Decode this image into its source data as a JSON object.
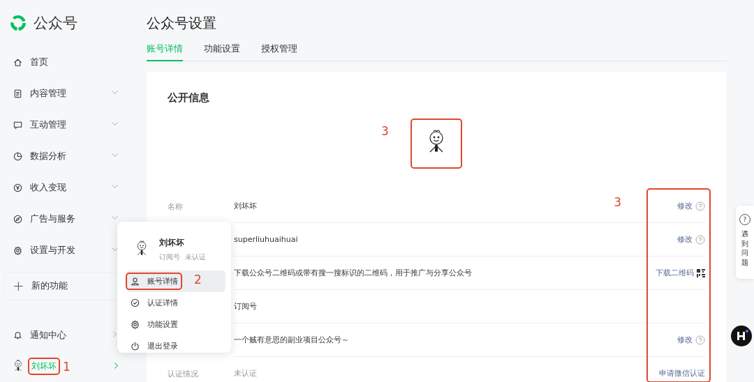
{
  "sidebar": {
    "brand": "公众号",
    "items": [
      {
        "label": "首页",
        "expandable": false
      },
      {
        "label": "内容管理",
        "expandable": true
      },
      {
        "label": "互动管理",
        "expandable": true
      },
      {
        "label": "数据分析",
        "expandable": true
      },
      {
        "label": "收入变现",
        "expandable": true
      },
      {
        "label": "广告与服务",
        "expandable": true
      },
      {
        "label": "设置与开发",
        "expandable": true
      }
    ],
    "new_feature": {
      "icon": "+",
      "label": "新的功能"
    },
    "notifications": {
      "label": "通知中心"
    },
    "user": {
      "name": "刘坏坏",
      "highlighted": true,
      "annotation": "1"
    }
  },
  "page": {
    "title": "公众号设置",
    "tabs": [
      {
        "label": "账号详情",
        "selected": true
      },
      {
        "label": "功能设置",
        "selected": false
      },
      {
        "label": "授权管理",
        "selected": false
      }
    ]
  },
  "card": {
    "title": "公开信息",
    "avatar_highlighted": true,
    "avatar_annotation": "3",
    "actions_highlighted": true,
    "actions_annotation": "3",
    "rows": [
      {
        "label": "名称",
        "value": "刘坏坏",
        "action": "修改",
        "kind": "help",
        "muted": false
      },
      {
        "value": "superliuhuaihuai",
        "action": "修改",
        "kind": "help",
        "muted": false
      },
      {
        "value": "下载公众号二维码或带有搜一搜标识的二维码，用于推广与分享公众号",
        "action": "下载二维码",
        "kind": "qr",
        "muted": false
      },
      {
        "value": "订阅号",
        "muted": false
      },
      {
        "value": "一个贼有意思的副业项目公众号～",
        "action": "修改",
        "kind": "help",
        "muted": false
      },
      {
        "label": "认证情况",
        "value": "未认证",
        "action": "申请微信认证",
        "kind": "plain",
        "muted": true
      }
    ]
  },
  "account_menu": {
    "name": "刘坏坏",
    "type": "订阅号",
    "status": "未认证",
    "items": [
      {
        "label": "账号详情",
        "selected": true,
        "highlighted": true,
        "annotation": "2"
      },
      {
        "label": "认证详情",
        "selected": false,
        "highlighted": false
      },
      {
        "label": "功能设置",
        "selected": false,
        "highlighted": false
      },
      {
        "label": "退出登录",
        "selected": false,
        "highlighted": false
      }
    ]
  },
  "help_widget": {
    "icon": "?",
    "label": "遇到问题"
  }
}
